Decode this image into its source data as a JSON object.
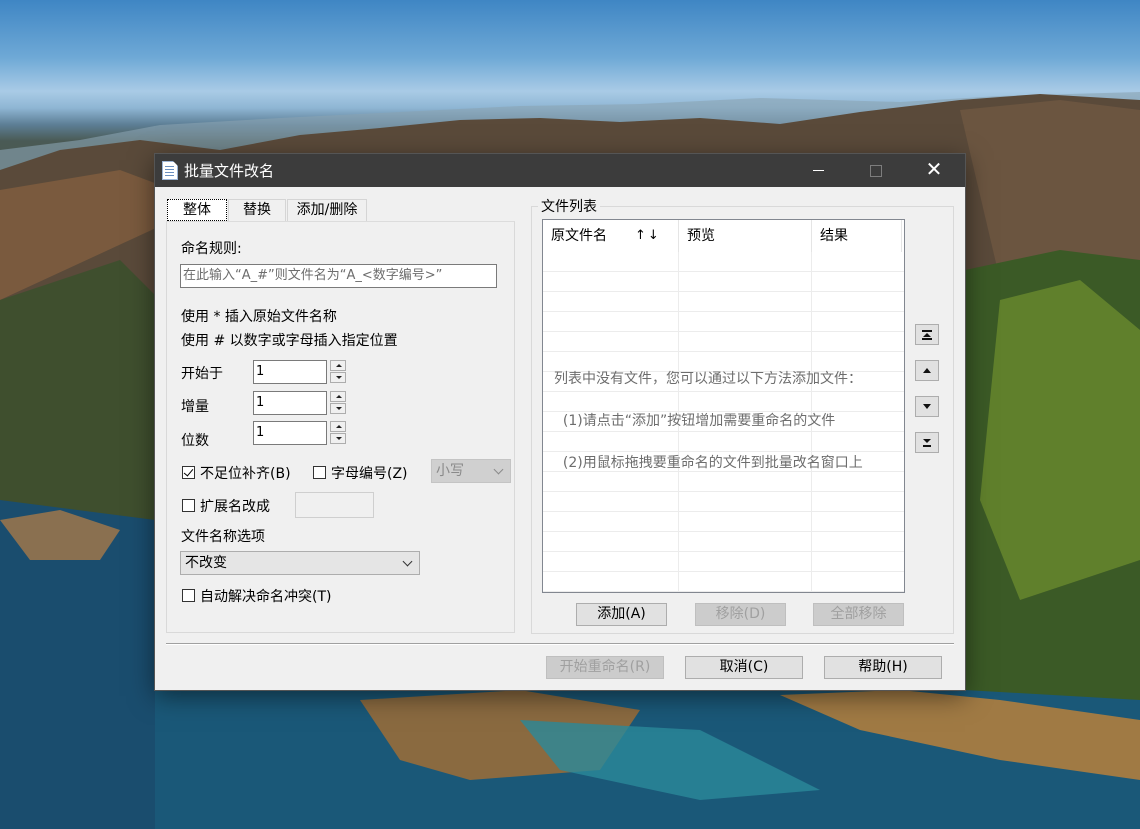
{
  "window": {
    "title": "批量文件改名",
    "minimize_icon": "minimize-icon",
    "maximize_icon": "maximize-icon",
    "close_label": "✕"
  },
  "tabs": [
    {
      "label": "整体",
      "active": true
    },
    {
      "label": "替换",
      "active": false
    },
    {
      "label": "添加/删除",
      "active": false
    }
  ],
  "general": {
    "naming_rule_label": "命名规则:",
    "naming_rule_placeholder": "在此输入“A_#”则文件名为“A_<数字编号>”",
    "hint_star": "使用 * 插入原始文件名称",
    "hint_hash": "使用 # 以数字或字母插入指定位置",
    "start_label": "开始于",
    "start_value": "1",
    "increment_label": "增量",
    "increment_value": "1",
    "digits_label": "位数",
    "digits_value": "1",
    "pad_label": "不足位补齐(B)",
    "pad_checked": true,
    "alpha_label": "字母编号(Z)",
    "alpha_checked": false,
    "case_value": "小写",
    "ext_label": "扩展名改成",
    "ext_checked": false,
    "ext_value": "",
    "filename_option_label": "文件名称选项",
    "filename_option_value": "不改变",
    "auto_resolve_label": "自动解决命名冲突(T)",
    "auto_resolve_checked": false
  },
  "file_list": {
    "group_title": "文件列表",
    "columns": [
      "原文件名",
      "预览",
      "结果"
    ],
    "sort_indicator": "↑↓",
    "empty_message": [
      "列表中没有文件，您可以通过以下方法添加文件：",
      "  (1)请点击“添加”按钮增加需要重命名的文件",
      "  (2)用鼠标拖拽要重命名的文件到批量改名窗口上"
    ],
    "add_button": "添加(A)",
    "remove_button": "移除(D)",
    "remove_all_button": "全部移除"
  },
  "footer": {
    "start_button": "开始重命名(R)",
    "cancel_button": "取消(C)",
    "help_button": "帮助(H)"
  },
  "colors": {
    "titlebar": "#3c3c3c",
    "window_bg": "#f0f0f0",
    "focus_border": "#0078d7"
  }
}
